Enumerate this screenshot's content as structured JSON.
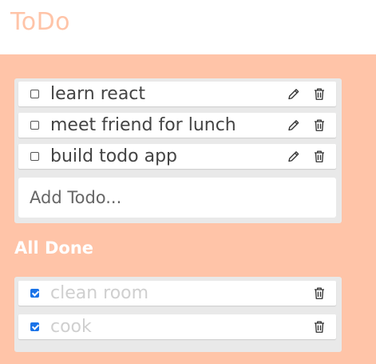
{
  "app": {
    "title": "ToDo"
  },
  "todo": {
    "items": [
      {
        "label": "learn react",
        "checked": false
      },
      {
        "label": "meet friend for lunch",
        "checked": false
      },
      {
        "label": "build todo app",
        "checked": false
      }
    ],
    "add_placeholder": "Add Todo..."
  },
  "done": {
    "title": "All Done",
    "items": [
      {
        "label": "clean room",
        "checked": true
      },
      {
        "label": "cook",
        "checked": true
      }
    ]
  },
  "colors": {
    "accent": "#ffc4a8",
    "card": "#e9e9e9",
    "checkbox_checked": "#1a73e8",
    "done_text": "#cfcfcf"
  },
  "icons": {
    "edit": "pencil-icon",
    "delete": "trash-icon"
  }
}
